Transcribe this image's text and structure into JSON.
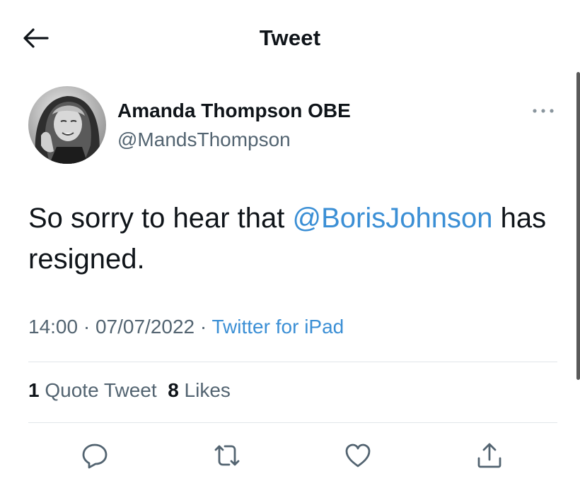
{
  "header": {
    "title": "Tweet",
    "back_icon": "arrow-left-icon"
  },
  "tweet": {
    "author": {
      "name": "Amanda Thompson OBE",
      "handle": "@MandsThompson"
    },
    "text_before_mention": "So sorry to hear that ",
    "mention": "@BorisJohnson",
    "text_after_mention": " has resigned.",
    "time": "14:00",
    "separator": " · ",
    "date": "07/07/2022",
    "source": "Twitter for iPad",
    "quote_tweets_count": "1",
    "quote_tweets_label": "Quote Tweet",
    "likes_count": "8",
    "likes_label": "Likes"
  },
  "colors": {
    "text": "#0f1419",
    "secondary": "#536471",
    "link": "#3b8fd5",
    "divider": "#e1e6ea"
  },
  "actions": [
    "reply-icon",
    "retweet-icon",
    "like-icon",
    "share-icon"
  ]
}
